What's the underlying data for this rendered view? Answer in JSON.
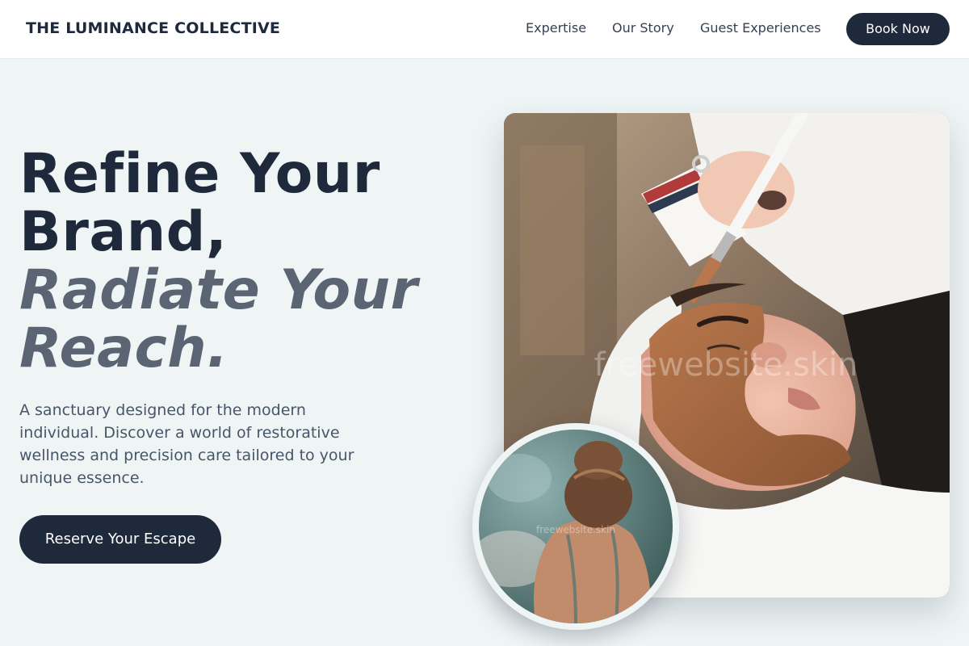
{
  "nav": {
    "brand": "THE LUMINANCE COLLECTIVE",
    "links": [
      "Expertise",
      "Our Story",
      "Guest Experiences"
    ],
    "cta": "Book Now"
  },
  "hero": {
    "headline_lines": [
      "Refine Your",
      "Brand,"
    ],
    "headline_accent_lines": [
      "Radiate Your",
      "Reach."
    ],
    "description": "A sanctuary designed for the modern individual. Discover a world of restorative wellness and precision care tailored to your unique essence.",
    "cta": "Reserve Your Escape"
  },
  "images": {
    "main_watermark": "freewebsite.skin",
    "inset_watermark": "freewebsite.skin"
  },
  "colors": {
    "primary": "#1e293b",
    "accent_text": "#5b6472",
    "background": "#eff5f5",
    "body_text": "#475569"
  }
}
